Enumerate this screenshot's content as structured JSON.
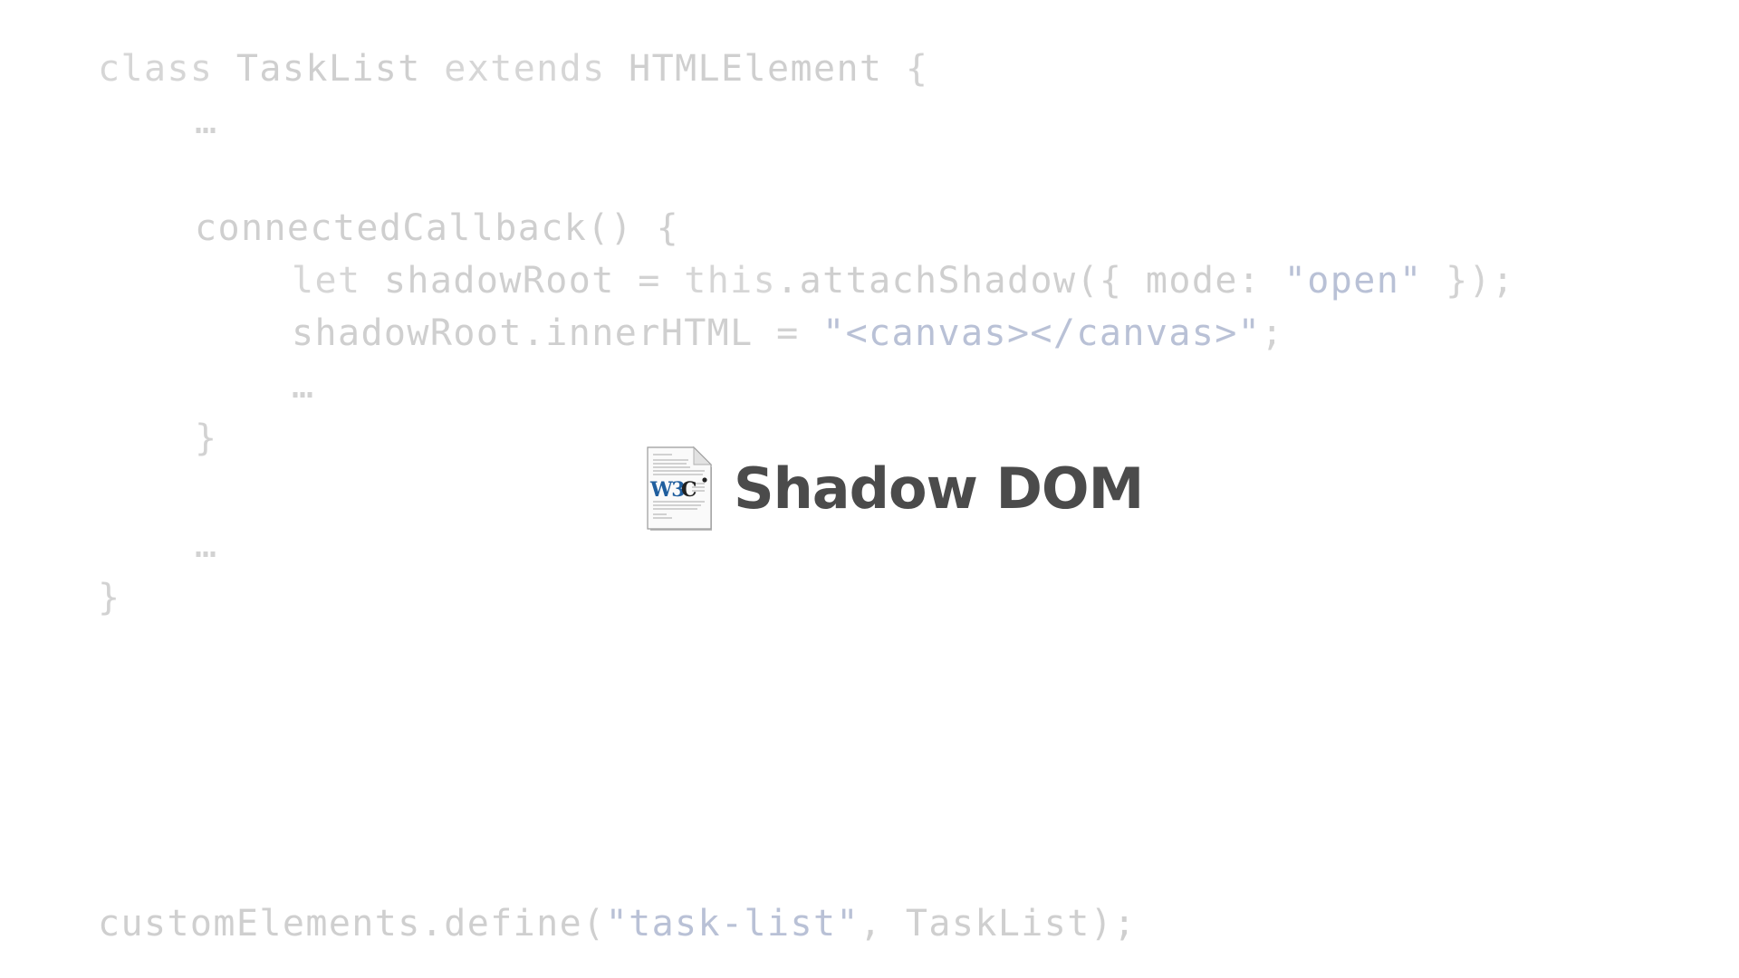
{
  "code": {
    "line1": {
      "kw_class": "class",
      "name": "TaskList",
      "kw_extends": "extends",
      "base": "HTMLElement",
      "brace": "{"
    },
    "line2": {
      "ellipsis": "…"
    },
    "line4": {
      "method": "connectedCallback() {"
    },
    "line5": {
      "kw_let": "let",
      "var": "shadowRoot",
      "eq": "=",
      "kw_this": "this",
      "call": ".attachShadow({ mode:",
      "str": "\"open\"",
      "end": "});"
    },
    "line6": {
      "lhs": "shadowRoot.innerHTML",
      "eq": "=",
      "str": "\"<canvas></canvas>\"",
      "end": ";"
    },
    "line7": {
      "ellipsis": "…"
    },
    "line8": {
      "brace": "}"
    },
    "line10": {
      "ellipsis": "…"
    },
    "line11": {
      "brace": "}"
    },
    "line_define": {
      "call": "customElements.define(",
      "str": "\"task-list\"",
      "end": ", TaskList);"
    }
  },
  "title": {
    "icon": "w3c-document-icon",
    "text": "Shadow DOM"
  },
  "colors": {
    "code_text": "#d2d2d2",
    "code_string": "#b9c1d6",
    "title_text": "#4b4b4b",
    "background": "#ffffff"
  }
}
